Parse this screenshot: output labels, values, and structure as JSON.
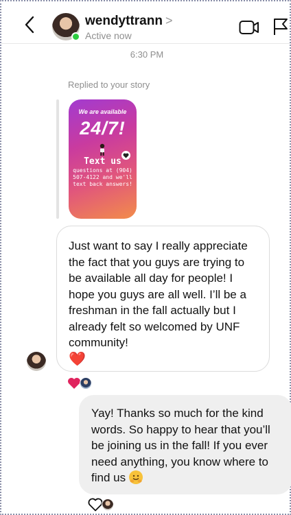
{
  "header": {
    "username": "wendyttrann",
    "username_chevron": ">",
    "status": "Active now"
  },
  "thread": {
    "timestamp": "6:30 PM",
    "reply_context": "Replied to your story"
  },
  "story": {
    "line1": "We are available",
    "line2": "24/7!",
    "line3": "Text us",
    "line4": "questions at (904) 507-4122 and we'll text back answers!"
  },
  "messages": {
    "incoming": {
      "text": "Just want to say I really appreciate the fact that you guys are trying to be available all day for people! I hope you guys are all well. I’ll be a freshman in the fall actually but I already felt so welcomed by UNF community!",
      "emoji": "❤️"
    },
    "outgoing": {
      "text": "Yay! Thanks so much for the kind words. So happy to hear that you’ll be joining us in the fall! If you ever need anything, you know where to find us"
    }
  },
  "colors": {
    "active": "#2ecc40",
    "heart": "#e0245e",
    "incoming_border": "#dbdbdb",
    "outgoing_bg": "#efefef",
    "muted_text": "#8e8e8e"
  },
  "icons": {
    "back": "chevron-left-icon",
    "video": "video-camera-icon",
    "flag": "flag-icon",
    "reaction_heart": "heart-icon",
    "reaction_outline": "heart-outline-icon",
    "emoji": "hugging-face-emoji"
  }
}
